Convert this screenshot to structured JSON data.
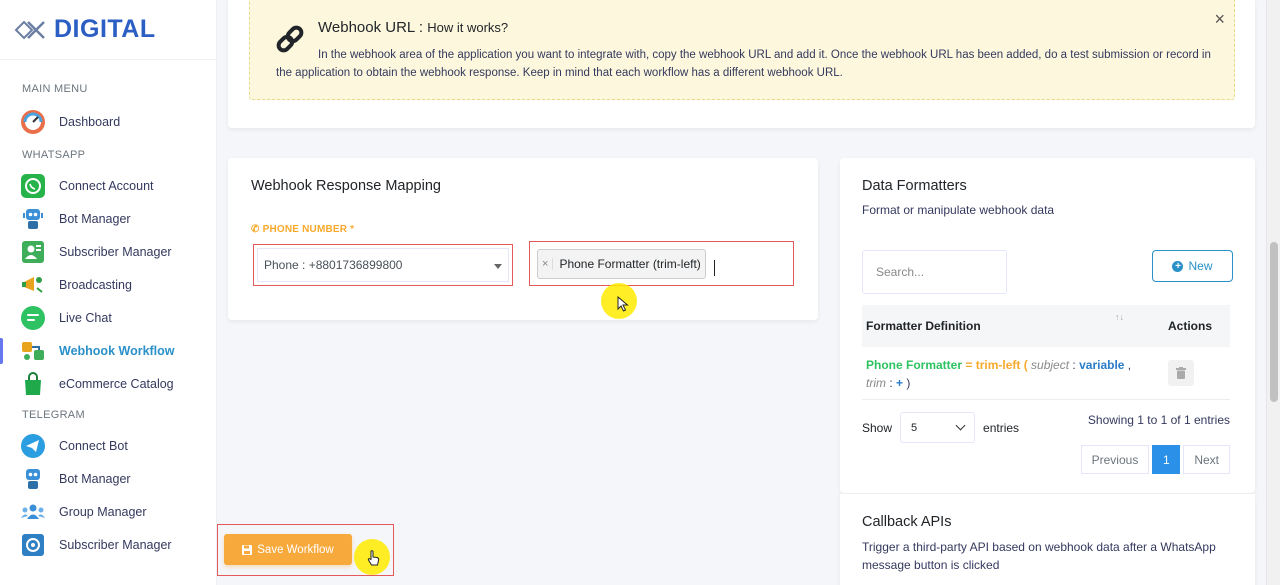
{
  "brand": {
    "name": "DIGITAL"
  },
  "sidebar": {
    "main_menu_header": "MAIN MENU",
    "main_items": [
      {
        "label": "Dashboard",
        "icon": "speedometer-icon"
      }
    ],
    "whatsapp_header": "WHATSAPP",
    "whatsapp_items": [
      {
        "label": "Connect Account",
        "icon": "whatsapp-icon"
      },
      {
        "label": "Bot Manager",
        "icon": "robot-icon"
      },
      {
        "label": "Subscriber Manager",
        "icon": "subscriber-icon"
      },
      {
        "label": "Broadcasting",
        "icon": "megaphone-icon"
      },
      {
        "label": "Live Chat",
        "icon": "chat-icon"
      },
      {
        "label": "Webhook Workflow",
        "icon": "workflow-icon",
        "active": true
      },
      {
        "label": "eCommerce Catalog",
        "icon": "shopping-bag-icon"
      }
    ],
    "telegram_header": "TELEGRAM",
    "telegram_items": [
      {
        "label": "Connect Bot",
        "icon": "telegram-icon"
      },
      {
        "label": "Bot Manager",
        "icon": "robot-icon"
      },
      {
        "label": "Group Manager",
        "icon": "group-icon"
      },
      {
        "label": "Subscriber Manager",
        "icon": "subscriber-icon"
      }
    ]
  },
  "alert": {
    "title": "Webhook URL :",
    "title_sub": "How it works?",
    "text": "In the webhook area of the application you want to integrate with, copy the webhook URL and add it. Once the webhook URL has been added, do a test submission or record in the application to obtain the webhook response. Keep in mind that each workflow has a different webhook URL.",
    "close": "×"
  },
  "mapping": {
    "title": "Webhook Response Mapping",
    "field_label": "PHONE NUMBER *",
    "selected_value": "Phone : +8801736899800",
    "tag_label": "Phone Formatter (trim-left)",
    "tag_remove": "×"
  },
  "formatters": {
    "title": "Data Formatters",
    "subtitle": "Format or manipulate webhook data",
    "search_placeholder": "Search...",
    "new_label": "New",
    "col_definition": "Formatter Definition",
    "col_actions": "Actions",
    "rows": [
      {
        "name": "Phone Formatter",
        "eq": " = ",
        "fn": "trim-left",
        "open": " ( ",
        "p1": "subject",
        "colon1": " : ",
        "v1": "variable",
        "comma": " ,",
        "p2": "trim",
        "colon2": " : ",
        "v2": "+",
        "close": " )"
      }
    ],
    "show_label": "Show",
    "entries_value": "5",
    "entries_label": "entries",
    "showing_text": "Showing 1 to 1 of 1 entries",
    "pagination": {
      "previous": "Previous",
      "current": "1",
      "next": "Next"
    }
  },
  "callback": {
    "title": "Callback APIs",
    "subtitle": "Trigger a third-party API based on webhook data after a WhatsApp message button is clicked"
  },
  "save": {
    "label": "Save Workflow"
  },
  "colors": {
    "accent_blue": "#2a90c8",
    "orange": "#f7a93c",
    "highlight_red": "#e45a5a",
    "alert_bg": "#fdf8dd"
  }
}
